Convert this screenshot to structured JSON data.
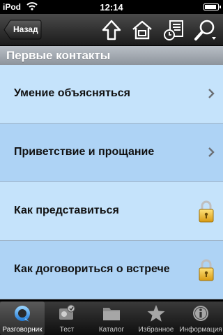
{
  "status_bar": {
    "carrier": "iPod",
    "time": "12:14",
    "battery_level": 0.9
  },
  "toolbar": {
    "back_label": "Назад",
    "icons": [
      "up-arrow-icon",
      "home-icon",
      "history-list-icon",
      "search-icon"
    ]
  },
  "section": {
    "title": "Первые контакты"
  },
  "list": {
    "items": [
      {
        "label": "Умение объясняться",
        "accessory": "chevron",
        "background": "#c5e3fb"
      },
      {
        "label": "Приветствие и прощание",
        "accessory": "chevron",
        "background": "#aed3f5"
      },
      {
        "label": "Как представиться",
        "accessory": "lock",
        "background": "#c5e3fb"
      },
      {
        "label": "Как договориться о встрече",
        "accessory": "lock",
        "background": "#aed3f5"
      }
    ]
  },
  "tab_bar": {
    "active_index": 0,
    "tabs": [
      {
        "label": "Разговорник",
        "icon": "phrasebook-icon"
      },
      {
        "label": "Тест",
        "icon": "test-icon"
      },
      {
        "label": "Каталог",
        "icon": "folder-icon"
      },
      {
        "label": "Избранное",
        "icon": "star-icon"
      },
      {
        "label": "Информация",
        "icon": "info-icon"
      }
    ]
  }
}
